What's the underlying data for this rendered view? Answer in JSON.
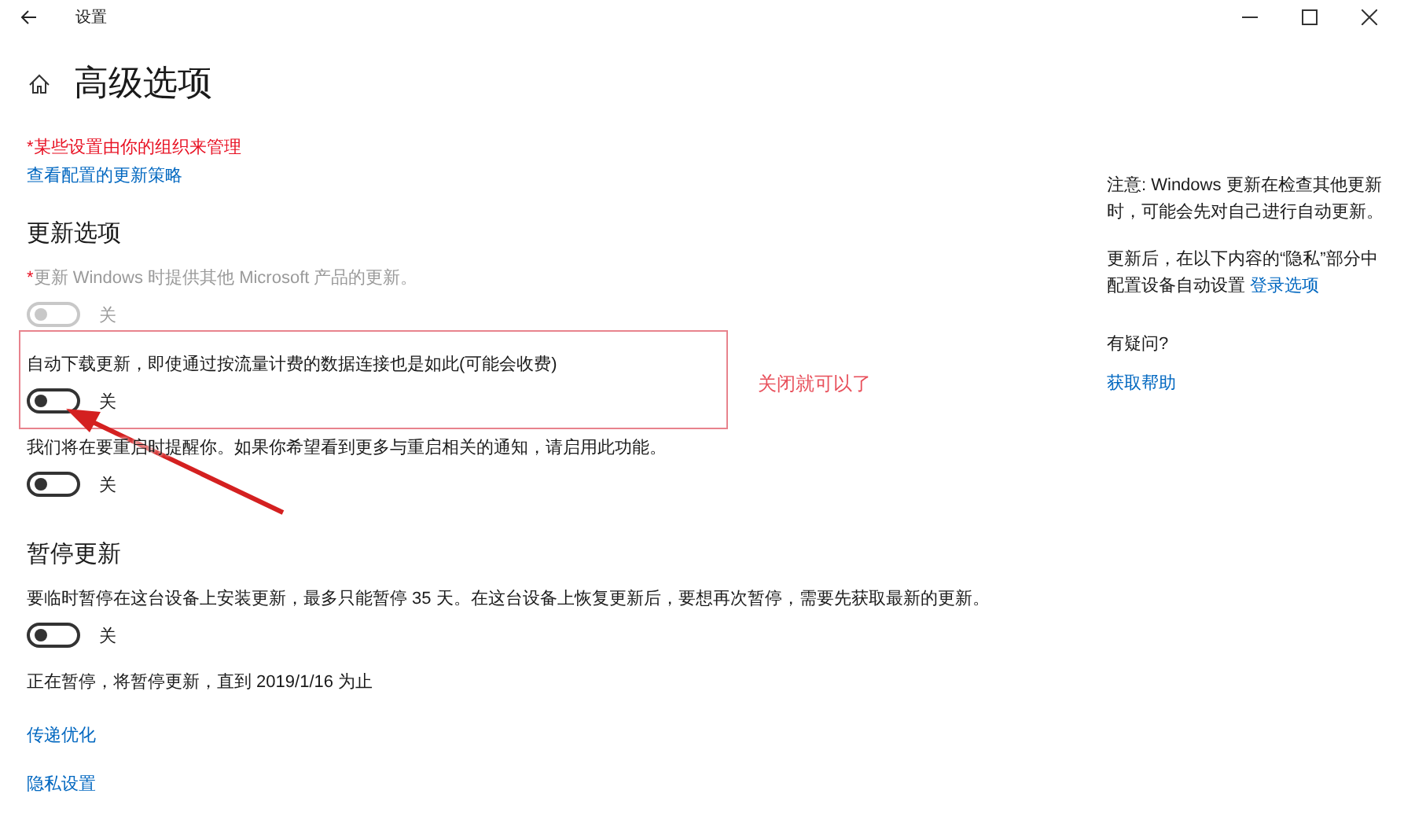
{
  "window": {
    "title": "设置"
  },
  "page": {
    "title": "高级选项"
  },
  "managed_note": "*某些设置由你的组织来管理",
  "policy_link": "查看配置的更新策略",
  "sections": [
    {
      "heading": "更新选项",
      "items": [
        {
          "kind": "toggle",
          "marker": "*",
          "label": "更新 Windows 时提供其他 Microsoft 产品的更新。",
          "on": false,
          "disabled": true,
          "highlighted": false,
          "state_label": "关"
        },
        {
          "kind": "toggle",
          "label": "自动下载更新，即使通过按流量计费的数据连接也是如此(可能会收费)",
          "on": false,
          "disabled": false,
          "highlighted": true,
          "state_label": "关"
        },
        {
          "kind": "toggle",
          "label": "我们将在要重启时提醒你。如果你希望看到更多与重启相关的通知，请启用此功能。",
          "on": false,
          "disabled": false,
          "highlighted": false,
          "state_label": "关"
        }
      ]
    },
    {
      "heading": "暂停更新",
      "items": [
        {
          "kind": "toggle",
          "label": "要临时暂停在这台设备上安装更新，最多只能暂停 35 天。在这台设备上恢复更新后，要想再次暂停，需要先获取最新的更新。",
          "on": false,
          "disabled": false,
          "highlighted": false,
          "state_label": "关"
        },
        {
          "kind": "text",
          "label": "正在暂停，将暂停更新，直到 2019/1/16 为止"
        }
      ]
    }
  ],
  "links": [
    "传递优化",
    "隐私设置"
  ],
  "side": [
    {
      "kind": "text",
      "text": "注意: Windows 更新在检查其他更新时，可能会先对自己进行自动更新。"
    },
    {
      "kind": "text",
      "text": "更新后，在以下内容的“隐私”部分中配置设备自动设置",
      "link": "登录选项"
    },
    {
      "kind": "question",
      "text": "有疑问?"
    },
    {
      "kind": "link",
      "text": "获取帮助"
    }
  ],
  "annotation": {
    "text": "关闭就可以了"
  }
}
